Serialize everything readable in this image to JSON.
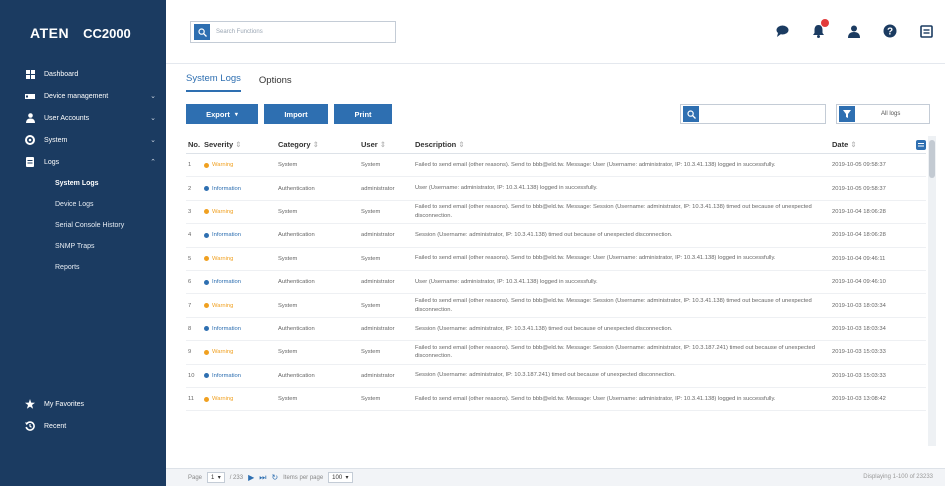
{
  "brand": {
    "logo": "ATEN",
    "model": "CC2000"
  },
  "sidebar": {
    "items": [
      {
        "label": "Dashboard",
        "icon": "dashboard-icon"
      },
      {
        "label": "Device management",
        "icon": "device-icon",
        "chevron": "⌄"
      },
      {
        "label": "User Accounts",
        "icon": "user-icon",
        "chevron": "⌄"
      },
      {
        "label": "System",
        "icon": "gear-icon",
        "chevron": "⌄"
      },
      {
        "label": "Logs",
        "icon": "logs-icon",
        "chevron": "⌃"
      }
    ],
    "sub_items": [
      {
        "label": "System Logs",
        "active": true
      },
      {
        "label": "Device Logs"
      },
      {
        "label": "Serial Console History"
      },
      {
        "label": "SNMP Traps"
      },
      {
        "label": "Reports"
      }
    ],
    "bottom": [
      {
        "label": "My Favorites",
        "icon": "star-icon"
      },
      {
        "label": "Recent",
        "icon": "history-icon"
      }
    ]
  },
  "topbar": {
    "search_placeholder": "Search Functions"
  },
  "tabs": [
    {
      "label": "System Logs",
      "active": true
    },
    {
      "label": "Options"
    }
  ],
  "toolbar": {
    "export_label": "Export",
    "import_label": "Import",
    "print_label": "Print",
    "log_filter": "All logs"
  },
  "table": {
    "headers": {
      "no": "No.",
      "severity": "Severity",
      "category": "Category",
      "user": "User",
      "description": "Description",
      "date": "Date"
    },
    "rows": [
      {
        "no": "1",
        "severity": "Warning",
        "category": "System",
        "user": "System",
        "description": "Failed to send email (other reasons). Send to bbb@eld.tw. Message: User (Username: administrator, IP: 10.3.41.138) logged in successfully.",
        "date": "2019-10-05 09:58:37"
      },
      {
        "no": "2",
        "severity": "Information",
        "category": "Authentication",
        "user": "administrator",
        "description": "User (Username: administrator, IP: 10.3.41.138) logged in successfully.",
        "date": "2019-10-05 09:58:37"
      },
      {
        "no": "3",
        "severity": "Warning",
        "category": "System",
        "user": "System",
        "description": "Failed to send email (other reasons). Send to bbb@eld.tw. Message: Session (Username: administrator, IP: 10.3.41.138) timed out because of unexpected disconnection.",
        "date": "2019-10-04 18:06:28"
      },
      {
        "no": "4",
        "severity": "Information",
        "category": "Authentication",
        "user": "administrator",
        "description": "Session (Username: administrator, IP: 10.3.41.138) timed out because of unexpected disconnection.",
        "date": "2019-10-04 18:06:28"
      },
      {
        "no": "5",
        "severity": "Warning",
        "category": "System",
        "user": "System",
        "description": "Failed to send email (other reasons). Send to bbb@eld.tw. Message: User (Username: administrator, IP: 10.3.41.138) logged in successfully.",
        "date": "2019-10-04 09:46:11"
      },
      {
        "no": "6",
        "severity": "Information",
        "category": "Authentication",
        "user": "administrator",
        "description": "User (Username: administrator, IP: 10.3.41.138) logged in successfully.",
        "date": "2019-10-04 09:46:10"
      },
      {
        "no": "7",
        "severity": "Warning",
        "category": "System",
        "user": "System",
        "description": "Failed to send email (other reasons). Send to bbb@eld.tw. Message: Session (Username: administrator, IP: 10.3.41.138) timed out because of unexpected disconnection.",
        "date": "2019-10-03 18:03:34"
      },
      {
        "no": "8",
        "severity": "Information",
        "category": "Authentication",
        "user": "administrator",
        "description": "Session (Username: administrator, IP: 10.3.41.138) timed out because of unexpected disconnection.",
        "date": "2019-10-03 18:03:34"
      },
      {
        "no": "9",
        "severity": "Warning",
        "category": "System",
        "user": "System",
        "description": "Failed to send email (other reasons). Send to bbb@eld.tw. Message: Session (Username: administrator, IP: 10.3.187.241) timed out because of unexpected disconnection.",
        "date": "2019-10-03 15:03:33"
      },
      {
        "no": "10",
        "severity": "Information",
        "category": "Authentication",
        "user": "administrator",
        "description": "Session (Username: administrator, IP: 10.3.187.241) timed out because of unexpected disconnection.",
        "date": "2019-10-03 15:03:33"
      },
      {
        "no": "11",
        "severity": "Warning",
        "category": "System",
        "user": "System",
        "description": "Failed to send email (other reasons). Send to bbb@eld.tw. Message: User (Username: administrator, IP: 10.3.41.138) logged in successfully.",
        "date": "2019-10-03 13:08:42"
      }
    ]
  },
  "footer": {
    "page_label": "Page",
    "page_value": "1",
    "page_total": "/ 233",
    "items_per_page_label": "Items per page",
    "items_per_page": "100",
    "displaying": "Displaying 1-100 of 23233"
  },
  "colors": {
    "sidebar": "#1b3b61",
    "accent": "#2e6fb1",
    "warning": "#f0a020",
    "info": "#2e6fb1"
  }
}
